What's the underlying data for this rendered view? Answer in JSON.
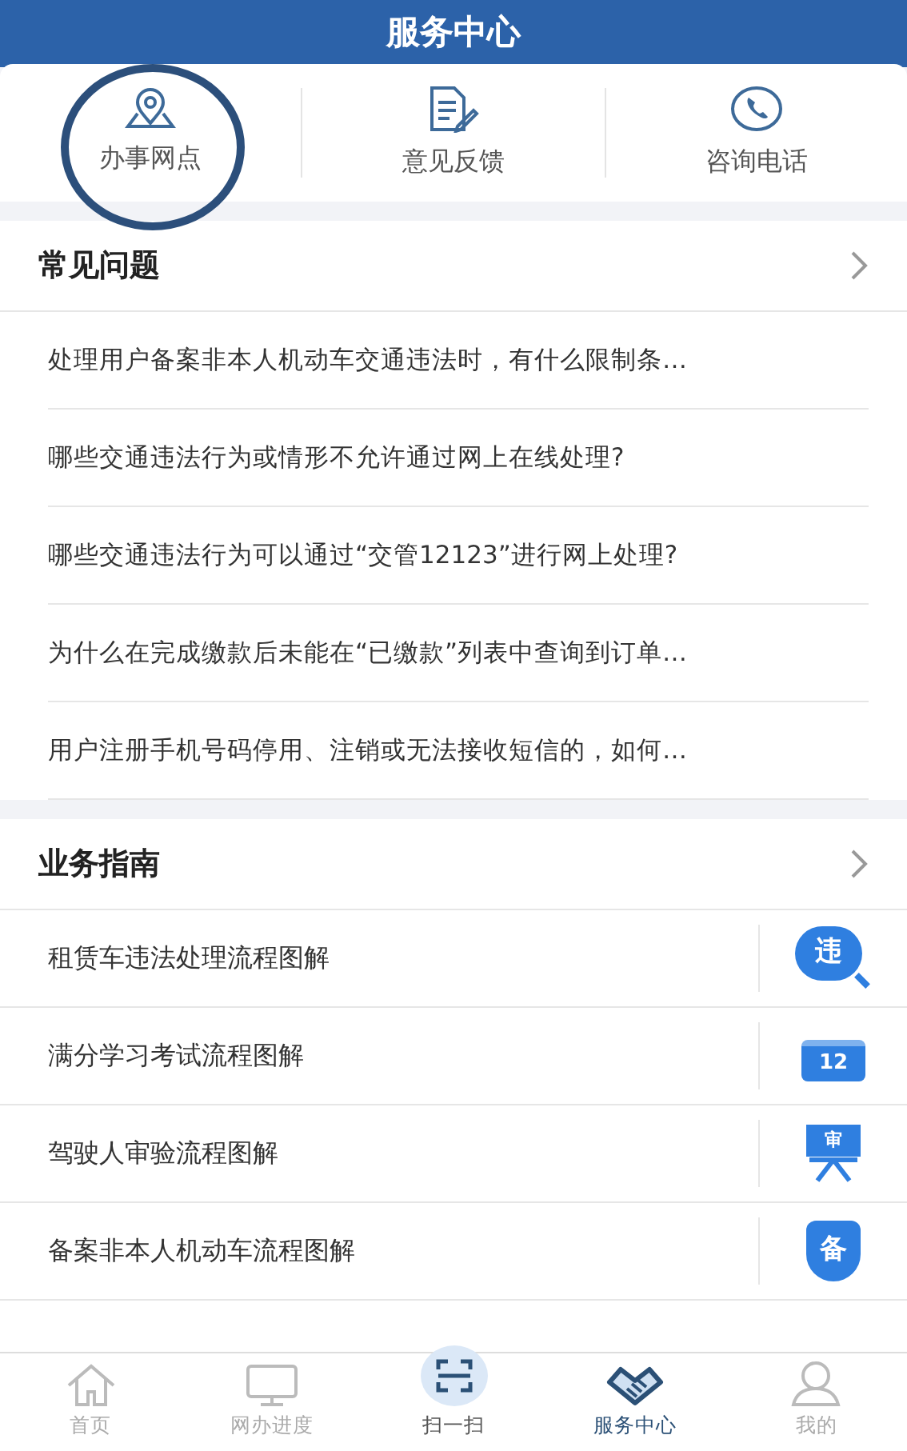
{
  "title": "服务中心",
  "quick_links": [
    {
      "kind": "pin",
      "label": "办事网点"
    },
    {
      "kind": "doc",
      "label": "意见反馈"
    },
    {
      "kind": "phone",
      "label": "咨询电话"
    }
  ],
  "faq": {
    "heading": "常见问题",
    "items": [
      "处理用户备案非本人机动车交通违法时，有什么限制条…",
      "哪些交通违法行为或情形不允许通过网上在线处理?",
      "哪些交通违法行为可以通过“交管12123”进行网上处理?",
      "为什么在完成缴款后未能在“已缴款”列表中查询到订单…",
      "用户注册手机号码停用、注销或无法接收短信的，如何…"
    ]
  },
  "guide": {
    "heading": "业务指南",
    "items": [
      {
        "label": "租赁车违法处理流程图解",
        "kind": "magnifier",
        "badge": "违"
      },
      {
        "label": "满分学习考试流程图解",
        "kind": "calendar",
        "badge": "12"
      },
      {
        "label": "驾驶人审验流程图解",
        "kind": "easel",
        "badge": "审"
      },
      {
        "label": "备案非本人机动车流程图解",
        "kind": "shield",
        "badge": "备"
      }
    ]
  },
  "tabbar": [
    {
      "kind": "home",
      "label": "首页",
      "selected": false
    },
    {
      "kind": "monitor",
      "label": "网办进度",
      "selected": false
    },
    {
      "kind": "scan",
      "label": "扫一扫",
      "selected": false
    },
    {
      "kind": "handshake",
      "label": "服务中心",
      "selected": true
    },
    {
      "kind": "person",
      "label": "我的",
      "selected": false
    }
  ]
}
